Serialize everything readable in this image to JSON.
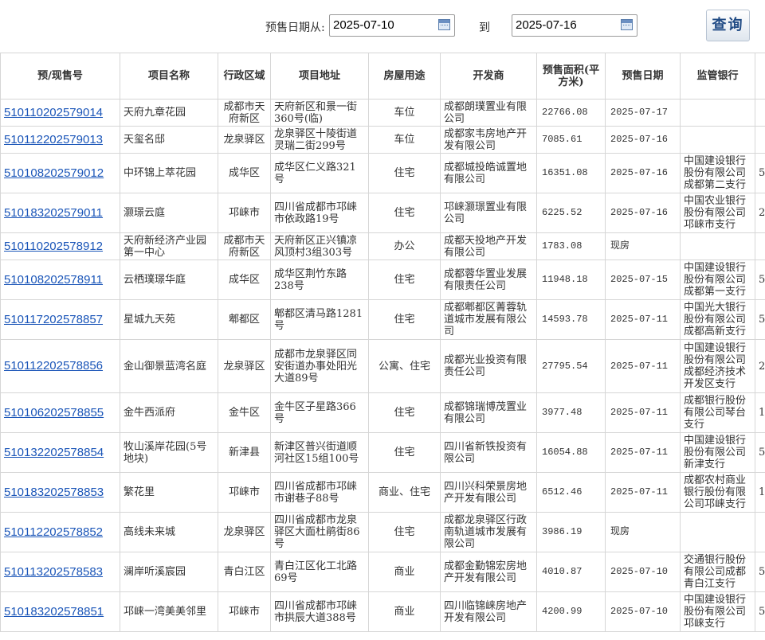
{
  "filter": {
    "from_label": "预售日期从:",
    "from_value": "2025-07-10",
    "to_label": "到",
    "to_value": "2025-07-16",
    "query_label": "查询"
  },
  "table": {
    "headers": [
      "预/现售号",
      "项目名称",
      "行政区域",
      "项目地址",
      "房屋用途",
      "开发商",
      "预售面积(平方米)",
      "预售日期",
      "监管银行",
      ""
    ],
    "rows": [
      [
        "510110202579014",
        "天府九章花园",
        "成都市天府新区",
        "天府新区和景一街360号(临)",
        "车位",
        "成都朗璞置业有限公司",
        "22766.08",
        "2025-07-17",
        "",
        ""
      ],
      [
        "510112202579013",
        "天玺名邸",
        "龙泉驿区",
        "龙泉驿区十陵街道灵瑞二街299号",
        "车位",
        "成都家韦房地产开发有限公司",
        "7085.61",
        "2025-07-16",
        "",
        ""
      ],
      [
        "510108202579012",
        "中环锦上萃花园",
        "成华区",
        "成华区仁义路321号",
        "住宅",
        "成都城投皓诚置地有限公司",
        "16351.08",
        "2025-07-16",
        "中国建设银行股份有限公司成都第二支行",
        "5"
      ],
      [
        "510183202579011",
        "灏璟云庭",
        "邛崃市",
        "四川省成都市邛崃市依政路19号",
        "住宅",
        "邛崃灏璟置业有限公司",
        "6225.52",
        "2025-07-16",
        "中国农业银行股份有限公司邛崃市支行",
        "2"
      ],
      [
        "510110202578912",
        "天府新经济产业园第一中心",
        "成都市天府新区",
        "天府新区正兴镇凉风顶村3组303号",
        "办公",
        "成都天投地产开发有限公司",
        "1783.08",
        "现房",
        "",
        ""
      ],
      [
        "510108202578911",
        "云栖璞璟华庭",
        "成华区",
        "成华区荆竹东路238号",
        "住宅",
        "成都蓉华置业发展有限责任公司",
        "11948.18",
        "2025-07-15",
        "中国建设银行股份有限公司成都第一支行",
        "5"
      ],
      [
        "510117202578857",
        "星城九天苑",
        "郫都区",
        "郫都区清马路1281号",
        "住宅",
        "成都郫都区菁蓉轨道城市发展有限公司",
        "14593.78",
        "2025-07-11",
        "中国光大银行股份有限公司成都高新支行",
        "5"
      ],
      [
        "510112202578856",
        "金山御景蓝湾名庭",
        "龙泉驿区",
        "成都市龙泉驿区同安街道办事处阳光大道89号",
        "公寓、住宅",
        "成都光业投资有限责任公司",
        "27795.54",
        "2025-07-11",
        "中国建设银行股份有限公司成都经济技术开发区支行",
        "2"
      ],
      [
        "510106202578855",
        "金牛西派府",
        "金牛区",
        "金牛区子星路366号",
        "住宅",
        "成都锦瑞博茂置业有限公司",
        "3977.48",
        "2025-07-11",
        "成都银行股份有限公司琴台支行",
        "1"
      ],
      [
        "510132202578854",
        "牧山溪岸花园(5号地块)",
        "新津县",
        "新津区普兴街道顺河社区15组100号",
        "住宅",
        "四川省新铁投资有限公司",
        "16054.88",
        "2025-07-11",
        "中国建设银行股份有限公司新津支行",
        "5"
      ],
      [
        "510183202578853",
        "繁花里",
        "邛崃市",
        "四川省成都市邛崃市谢巷子88号",
        "商业、住宅",
        "四川兴科荣景房地产开发有限公司",
        "6512.46",
        "2025-07-11",
        "成都农村商业银行股份有限公司邛崃支行",
        "1"
      ],
      [
        "510112202578852",
        "高线未来城",
        "龙泉驿区",
        "四川省成都市龙泉驿区大面杜鹃街86号",
        "住宅",
        "成都龙泉驿区行政南轨道城市发展有限公司",
        "3986.19",
        "现房",
        "",
        ""
      ],
      [
        "510113202578583",
        "澜岸听溪宸园",
        "青白江区",
        "青白江区化工北路69号",
        "商业",
        "成都金勤锦宏房地产开发有限公司",
        "4010.87",
        "2025-07-10",
        "交通银行股份有限公司成都青白江支行",
        "5"
      ],
      [
        "510183202578851",
        "邛崃一湾美美邻里",
        "邛崃市",
        "四川省成都市邛崃市拱辰大道388号",
        "商业",
        "四川临锦崃房地产开发有限公司",
        "4200.99",
        "2025-07-10",
        "中国建设银行股份有限公司邛崃支行",
        "5"
      ]
    ]
  }
}
